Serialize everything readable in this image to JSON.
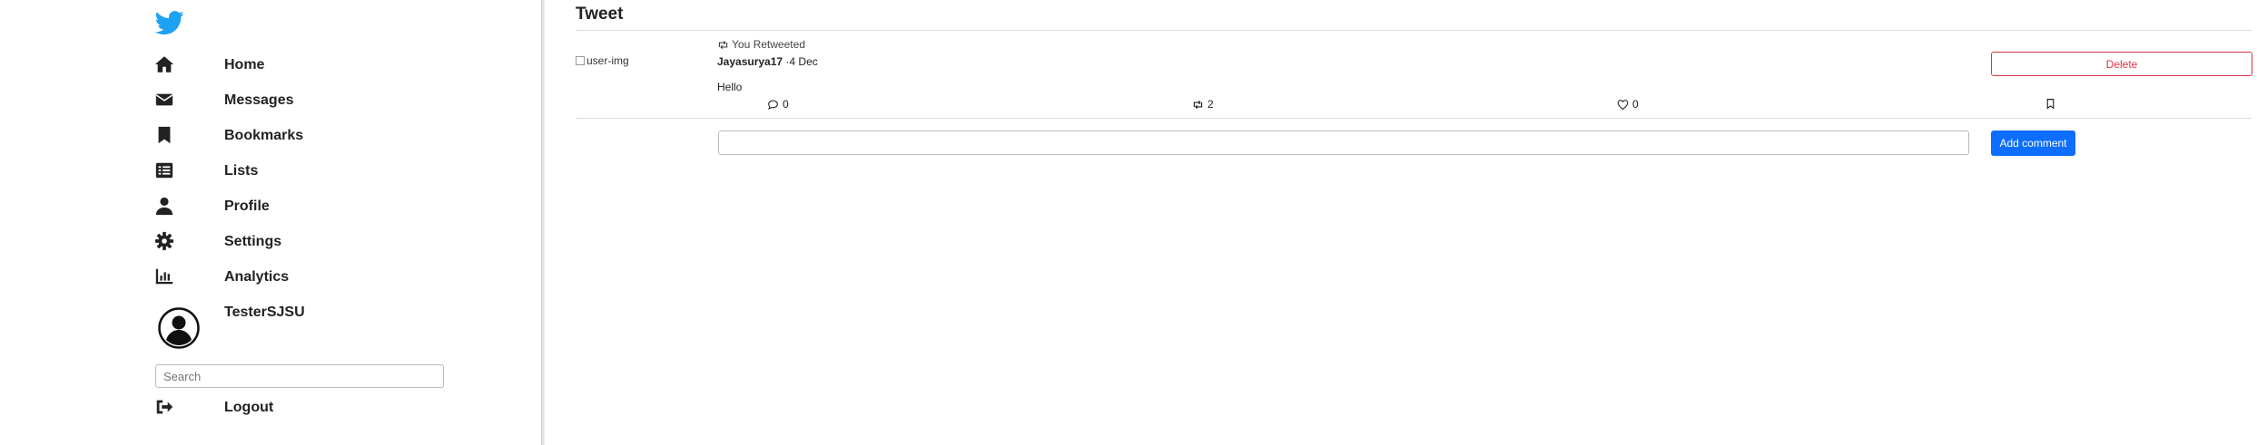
{
  "sidebar": {
    "logo": "twitter-bird-icon",
    "items": [
      {
        "label": "Home",
        "icon": "home-icon"
      },
      {
        "label": "Messages",
        "icon": "envelope-icon"
      },
      {
        "label": "Bookmarks",
        "icon": "bookmark-icon"
      },
      {
        "label": "Lists",
        "icon": "list-icon"
      },
      {
        "label": "Profile",
        "icon": "user-icon"
      },
      {
        "label": "Settings",
        "icon": "gear-icon"
      },
      {
        "label": "Analytics",
        "icon": "chart-icon"
      }
    ],
    "profile": {
      "name": "TesterSJSU",
      "icon": "avatar-icon"
    },
    "search_placeholder": "Search",
    "logout": {
      "label": "Logout",
      "icon": "logout-icon"
    }
  },
  "main": {
    "title": "Tweet",
    "tweet": {
      "image_alt": "user-img",
      "retweeted_label": "You Retweeted",
      "author": "Jayasurya17",
      "date": "·4 Dec",
      "text": "Hello",
      "comments": "0",
      "retweets": "2",
      "likes": "0",
      "delete_label": "Delete"
    },
    "comment": {
      "value": "",
      "button_label": "Add comment"
    }
  },
  "colors": {
    "brand": "#1da1f2",
    "danger": "#dc3545",
    "primary": "#0d6efd"
  }
}
